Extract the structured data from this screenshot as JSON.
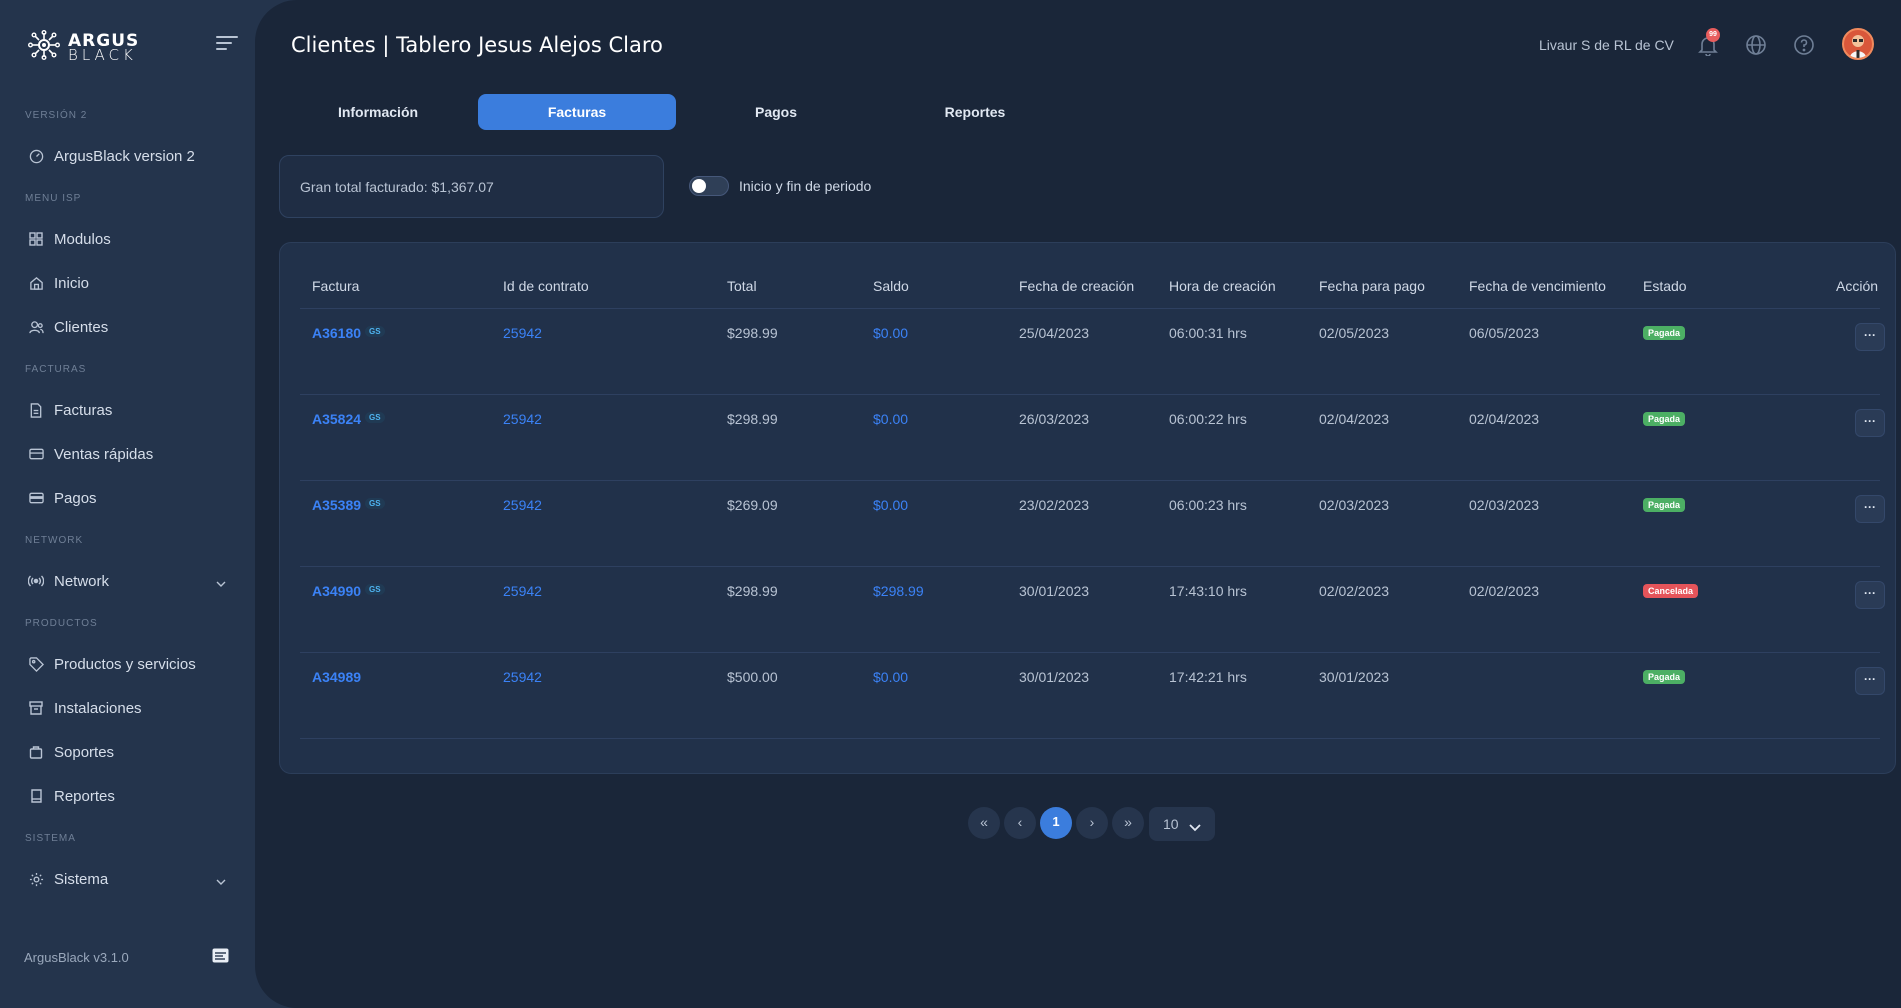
{
  "sidebar": {
    "logo_line1": "ARGUS",
    "logo_line2": "BLACK",
    "sections": {
      "version": "VERSIÓN 2",
      "menu_isp": "MENU ISP",
      "facturas": "FACTURAS",
      "network": "NETWORK",
      "productos": "PRODUCTOS",
      "sistema": "SISTEMA"
    },
    "items": {
      "argusblack_v2": "ArgusBlack version 2",
      "modulos": "Modulos",
      "inicio": "Inicio",
      "clientes": "Clientes",
      "facturas": "Facturas",
      "ventas_rapidas": "Ventas rápidas",
      "pagos": "Pagos",
      "network": "Network",
      "productos_servicios": "Productos y servicios",
      "instalaciones": "Instalaciones",
      "soportes": "Soportes",
      "reportes": "Reportes",
      "sistema": "Sistema"
    },
    "version_label": "ArgusBlack v3.1.0"
  },
  "header": {
    "title": "Clientes | Tablero Jesus Alejos Claro",
    "organization": "Livaur S de RL de CV",
    "notification_count": "99"
  },
  "tabs": [
    "Información",
    "Facturas",
    "Pagos",
    "Reportes"
  ],
  "active_tab": "Facturas",
  "summary": {
    "total_label": "Gran total facturado: $1,367.07",
    "toggle_label": "Inicio y fin de periodo",
    "toggle_on": false
  },
  "table": {
    "headers": [
      "Factura",
      "Id de contrato",
      "Total",
      "Saldo",
      "Fecha de creación",
      "Hora de creación",
      "Fecha para pago",
      "Fecha de vencimiento",
      "Estado",
      "Acción"
    ],
    "rows": [
      {
        "factura": "A36180",
        "gs": "GS",
        "contrato": "25942",
        "total": "$298.99",
        "saldo": "$0.00",
        "fecha_creacion": "25/04/2023",
        "hora": "06:00:31 hrs",
        "fecha_pago": "02/05/2023",
        "vencimiento": "06/05/2023",
        "estado": "Pagada",
        "accion": "···"
      },
      {
        "factura": "A35824",
        "gs": "GS",
        "contrato": "25942",
        "total": "$298.99",
        "saldo": "$0.00",
        "fecha_creacion": "26/03/2023",
        "hora": "06:00:22 hrs",
        "fecha_pago": "02/04/2023",
        "vencimiento": "02/04/2023",
        "estado": "Pagada",
        "accion": "···"
      },
      {
        "factura": "A35389",
        "gs": "GS",
        "contrato": "25942",
        "total": "$269.09",
        "saldo": "$0.00",
        "fecha_creacion": "23/02/2023",
        "hora": "06:00:23 hrs",
        "fecha_pago": "02/03/2023",
        "vencimiento": "02/03/2023",
        "estado": "Pagada",
        "accion": "···"
      },
      {
        "factura": "A34990",
        "gs": "GS",
        "contrato": "25942",
        "total": "$298.99",
        "saldo": "$298.99",
        "fecha_creacion": "30/01/2023",
        "hora": "17:43:10 hrs",
        "fecha_pago": "02/02/2023",
        "vencimiento": "02/02/2023",
        "estado": "Cancelada",
        "accion": "···"
      },
      {
        "factura": "A34989",
        "gs": "",
        "contrato": "25942",
        "total": "$500.00",
        "saldo": "$0.00",
        "fecha_creacion": "30/01/2023",
        "hora": "17:42:21 hrs",
        "fecha_pago": "30/01/2023",
        "vencimiento": "",
        "estado": "Pagada",
        "accion": "···"
      }
    ]
  },
  "pagination": {
    "first": "«",
    "prev": "‹",
    "current": "1",
    "next": "›",
    "last": "»",
    "page_size": "10"
  },
  "colors": {
    "accent": "#3b7ddd",
    "paid": "#4caf64",
    "cancelled": "#e5545a",
    "link": "#3b82f6"
  }
}
